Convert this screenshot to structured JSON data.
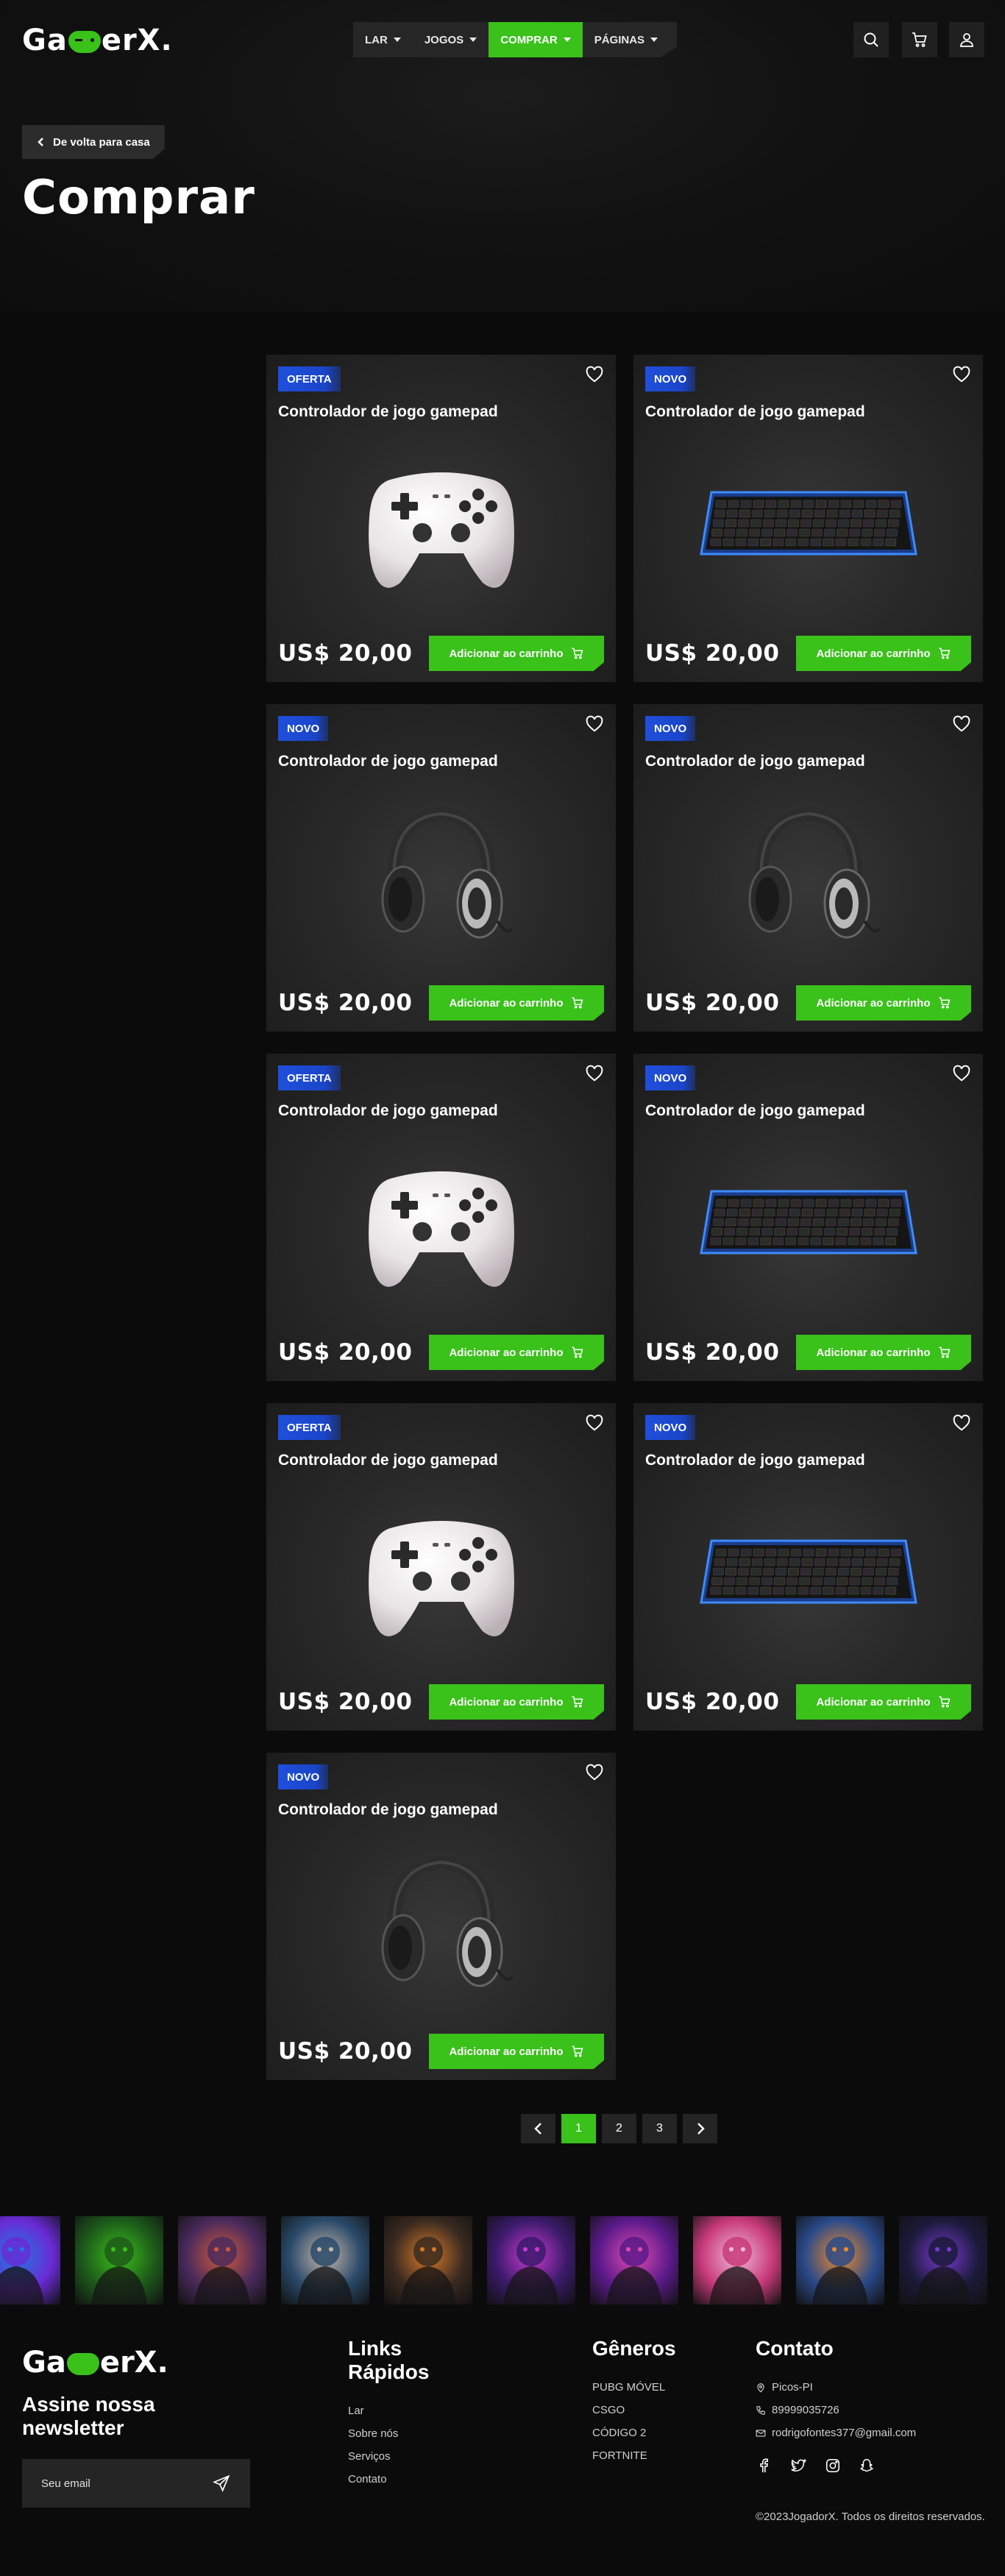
{
  "header": {
    "logo_left": "Ga",
    "logo_right": "erX.",
    "nav": [
      {
        "label": "LAR"
      },
      {
        "label": "JOGOS"
      },
      {
        "label": "COMPRAR"
      },
      {
        "label": "PÁGINAS"
      }
    ],
    "icons": [
      "search-icon",
      "cart-icon",
      "user-icon"
    ]
  },
  "hero": {
    "back_label": "De volta para casa",
    "title": "Comprar"
  },
  "products": [
    {
      "badge": "OFERTA",
      "title": "Controlador de jogo gamepad",
      "price": "US$ 20,00",
      "button": "Adicionar ao carrinho",
      "image": "controller"
    },
    {
      "badge": "NOVO",
      "title": "Controlador de jogo gamepad",
      "price": "US$ 20,00",
      "button": "Adicionar ao carrinho",
      "image": "keyboard"
    },
    {
      "badge": "NOVO",
      "title": "Controlador de jogo gamepad",
      "price": "US$ 20,00",
      "button": "Adicionar ao carrinho",
      "image": "headset"
    },
    {
      "badge": "NOVO",
      "title": "Controlador de jogo gamepad",
      "price": "US$ 20,00",
      "button": "Adicionar ao carrinho",
      "image": "headset"
    },
    {
      "badge": "OFERTA",
      "title": "Controlador de jogo gamepad",
      "price": "US$ 20,00",
      "button": "Adicionar ao carrinho",
      "image": "controller"
    },
    {
      "badge": "NOVO",
      "title": "Controlador de jogo gamepad",
      "price": "US$ 20,00",
      "button": "Adicionar ao carrinho",
      "image": "keyboard"
    },
    {
      "badge": "OFERTA",
      "title": "Controlador de jogo gamepad",
      "price": "US$ 20,00",
      "button": "Adicionar ao carrinho",
      "image": "controller"
    },
    {
      "badge": "NOVO",
      "title": "Controlador de jogo gamepad",
      "price": "US$ 20,00",
      "button": "Adicionar ao carrinho",
      "image": "keyboard"
    },
    {
      "badge": "NOVO",
      "title": "Controlador de jogo gamepad",
      "price": "US$ 20,00",
      "button": "Adicionar ao carrinho",
      "image": "headset"
    }
  ],
  "pagination": {
    "pages": [
      "1",
      "2",
      "3"
    ],
    "current": "1"
  },
  "gallery": [
    {
      "c1": "#6a2bd6",
      "c2": "#1d7be0"
    },
    {
      "c1": "#1d5a1a",
      "c2": "#3ac11a"
    },
    {
      "c1": "#4a2a5c",
      "c2": "#d05a3a"
    },
    {
      "c1": "#2a4a6a",
      "c2": "#c8b8a8"
    },
    {
      "c1": "#3a2a20",
      "c2": "#d87a2a"
    },
    {
      "c1": "#3a1a6a",
      "c2": "#c83ad0"
    },
    {
      "c1": "#5a1a8a",
      "c2": "#e04ab0"
    },
    {
      "c1": "#c83a7a",
      "c2": "#f0b8d8"
    },
    {
      "c1": "#2a4a8a",
      "c2": "#f08a2a"
    },
    {
      "c1": "#1a1a3a",
      "c2": "#7a3ad0"
    }
  ],
  "footer": {
    "logo_left": "Ga",
    "logo_right": "erX.",
    "newsletter_title": "Assine nossa newsletter",
    "email_placeholder": "Seu email",
    "links_title": "Links Rápidos",
    "links": [
      "Lar",
      "Sobre nós",
      "Serviços",
      "Contato"
    ],
    "genres_title": "Gêneros",
    "genres": [
      "PUBG MÓVEL",
      "CSGO",
      "CÓDIGO 2",
      "FORTNITE"
    ],
    "contact_title": "Contato",
    "contact": {
      "location": "Picos-PI",
      "phone": "89999035726",
      "email": "rodrigofontes377@gmail.com"
    },
    "social": [
      "facebook-icon",
      "twitter-icon",
      "instagram-icon",
      "snapchat-icon"
    ],
    "copyright": "©2023JogadorX. Todos os direitos reservados."
  },
  "colors": {
    "accent": "#3ac11a",
    "badge": "#1f4fdc",
    "background": "#0b0b0b"
  }
}
